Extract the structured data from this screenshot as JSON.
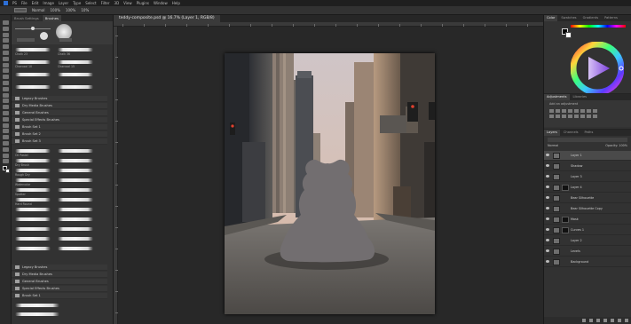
{
  "app": {
    "name": "Photoshop",
    "brand_color": "#2d6fd6"
  },
  "menu": [
    "PS",
    "File",
    "Edit",
    "Image",
    "Layer",
    "Type",
    "Select",
    "Filter",
    "3D",
    "View",
    "Plugins",
    "Window",
    "Help"
  ],
  "options": {
    "mode": "Normal",
    "opacity": "100%",
    "flow": "100%",
    "smoothing": "10%"
  },
  "document": {
    "tab_title": "teddy-composite.psd @ 16.7% (Layer 1, RGB/8)"
  },
  "brush_panel": {
    "tabs": [
      "Brush Settings",
      "Brushes"
    ],
    "active_tab": 1,
    "folders": [
      "Legacy Brushes",
      "Dry Media Brushes",
      "General Brushes",
      "Special Effects Brushes",
      "Brush Set 1",
      "Brush Set 2",
      "Brush Set 3"
    ],
    "brush_names": [
      "Chalk 23",
      "Chalk 36",
      "Charcoal 10",
      "Charcoal 15",
      "Oil Pastel",
      "Dry Brush",
      "Rough Dry",
      "Watercolor",
      "Spatter",
      "Hard Round"
    ]
  },
  "color_panel": {
    "tabs": [
      "Color",
      "Swatches",
      "Gradients",
      "Patterns"
    ],
    "foreground": "#000000",
    "background": "#ffffff"
  },
  "adjustments_panel": {
    "tabs": [
      "Adjustments",
      "Libraries"
    ],
    "hint": "Add an adjustment"
  },
  "layers_panel": {
    "tabs": [
      "Layers",
      "Channels",
      "Paths"
    ],
    "blend_mode": "Normal",
    "opacity_label": "Opacity: 100%",
    "layers": [
      "Layer 1",
      "Shadow",
      "Layer 3",
      "Layer 4",
      "Bear Silhouette",
      "Bear Silhouette Copy",
      "Mask",
      "Curves 1",
      "Layer 2",
      "Levels",
      "Background"
    ]
  }
}
